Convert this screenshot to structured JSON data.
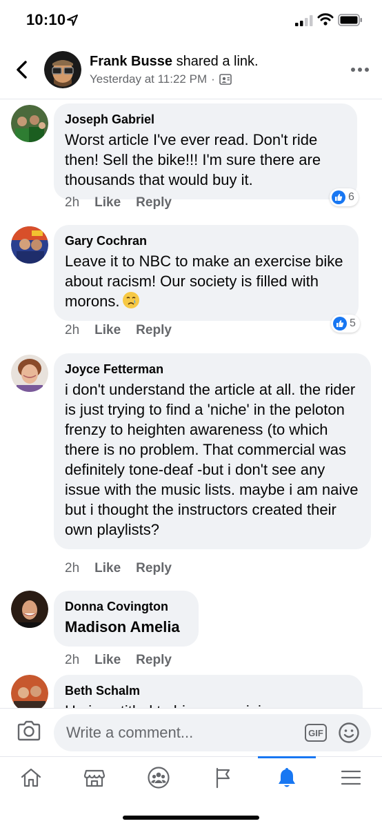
{
  "status_bar": {
    "time": "10:10"
  },
  "post_header": {
    "author": "Frank Busse",
    "action_text": "shared a link.",
    "timestamp": "Yesterday at 11:22 PM",
    "separator": "·"
  },
  "comments": [
    {
      "author": "Joseph Gabriel",
      "text": "Worst article I've ever read. Don't ride then! Sell the bike!!! I'm sure there are thousands that would buy it.",
      "time": "2h",
      "like_label": "Like",
      "reply_label": "Reply",
      "reaction_count": "6"
    },
    {
      "author": "Gary Cochran",
      "text": "Leave it to NBC to make an exercise bike about racism! Our society is filled with morons.",
      "time": "2h",
      "like_label": "Like",
      "reply_label": "Reply",
      "reaction_count": "5"
    },
    {
      "author": "Joyce Fetterman",
      "text": "i don't understand the article at all.   the rider is just trying to find a 'niche' in the peloton frenzy to heighten awareness (to which there is no problem.  That commercial was definitely tone-deaf -but i don't see any issue with the music lists.  maybe i am naive but i thought the instructors created their own playlists?",
      "time": "2h",
      "like_label": "Like",
      "reply_label": "Reply"
    },
    {
      "author": "Donna Covington",
      "text": "Madison Amelia",
      "time": "2h",
      "like_label": "Like",
      "reply_label": "Reply"
    },
    {
      "author": "Beth Schalm",
      "text": "He is entitled to his own opinion"
    }
  ],
  "composer": {
    "placeholder": "Write a comment...",
    "gif_label": "GIF"
  },
  "tabs": [
    "home",
    "marketplace",
    "groups",
    "pages",
    "notifications",
    "menu"
  ],
  "active_tab": "notifications",
  "colors": {
    "accent": "#1877f2",
    "bubble": "#f0f2f5",
    "secondary_text": "#65676b"
  }
}
